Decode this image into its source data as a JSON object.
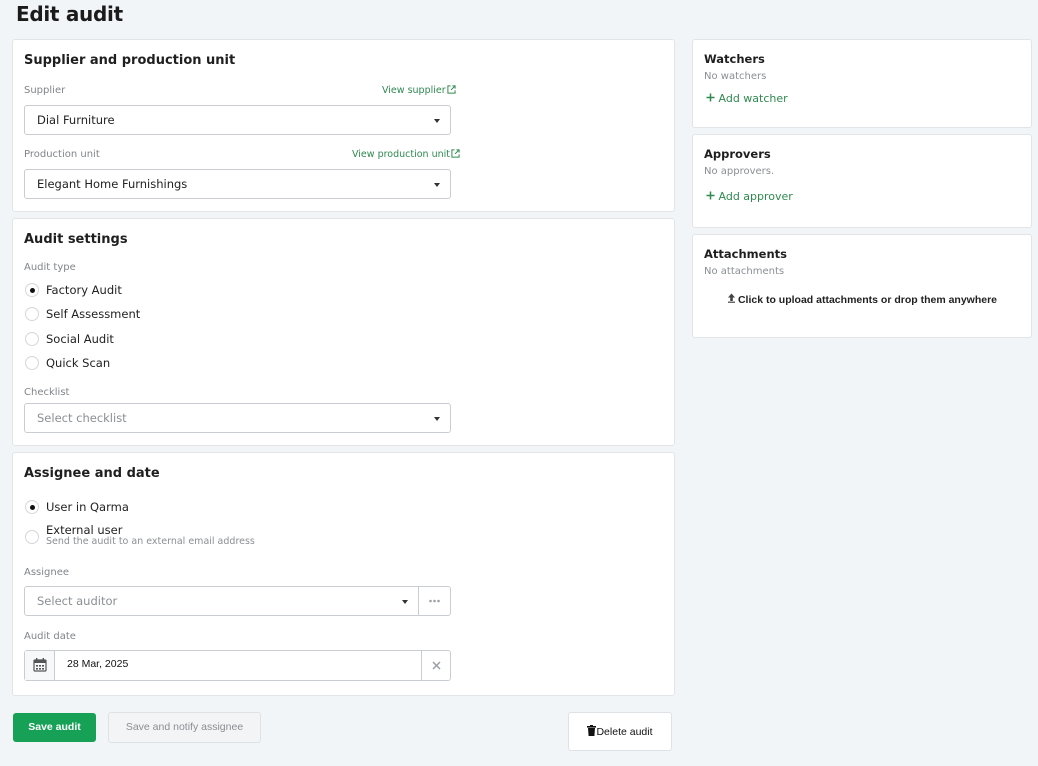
{
  "page": {
    "title": "Edit audit"
  },
  "supplier_section": {
    "title": "Supplier and production unit",
    "supplier_label": "Supplier",
    "view_supplier_link": "View supplier",
    "supplier_value": "Dial Furniture",
    "production_unit_label": "Production unit",
    "view_production_unit_link": "View production unit",
    "production_unit_value": "Elegant Home Furnishings"
  },
  "audit_settings": {
    "title": "Audit settings",
    "audit_type_label": "Audit type",
    "audit_types": [
      {
        "label": "Factory Audit",
        "checked": true
      },
      {
        "label": "Self Assessment",
        "checked": false
      },
      {
        "label": "Social Audit",
        "checked": false
      },
      {
        "label": "Quick Scan",
        "checked": false
      }
    ],
    "checklist_label": "Checklist",
    "checklist_placeholder": "Select checklist"
  },
  "assignee_section": {
    "title": "Assignee and date",
    "options": [
      {
        "label": "User in Qarma",
        "checked": true
      },
      {
        "label": "External user",
        "sub": "Send the audit to an external email address",
        "checked": false
      }
    ],
    "assignee_label": "Assignee",
    "assignee_placeholder": "Select auditor",
    "audit_date_label": "Audit date",
    "audit_date_value": "28 Mar, 2025"
  },
  "actions": {
    "save": "Save audit",
    "save_notify": "Save and notify assignee",
    "delete": "Delete audit"
  },
  "watchers": {
    "title": "Watchers",
    "empty": "No watchers",
    "add": "Add watcher"
  },
  "approvers": {
    "title": "Approvers",
    "empty": "No approvers.",
    "add": "Add approver"
  },
  "attachments": {
    "title": "Attachments",
    "empty": "No attachments",
    "upload": "Click to upload attachments or drop them anywhere"
  },
  "colors": {
    "accent": "#16a156",
    "link": "#2e8a4f",
    "background": "#f2f5f7"
  },
  "icons": [
    "external-link-icon",
    "caret-down-icon",
    "calendar-icon",
    "clear-icon",
    "more-icon",
    "plus-icon",
    "upload-icon",
    "trash-icon"
  ]
}
